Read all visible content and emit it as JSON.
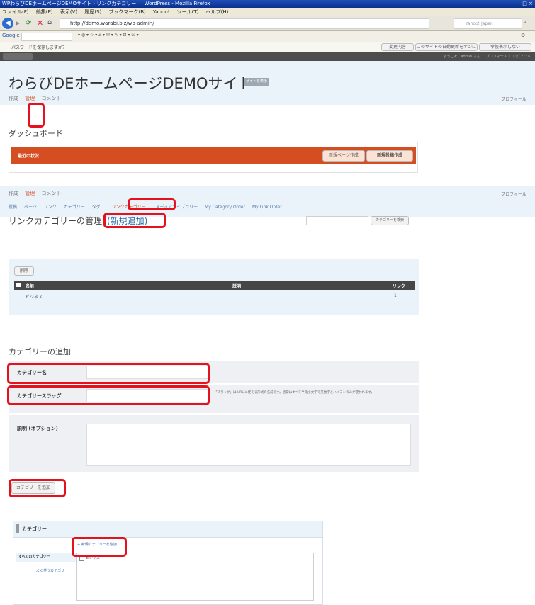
{
  "browser": {
    "title": "WPわらびDEホームページDEMOサイト › リンクカテゴリー — WordPress - Mozilla Firefox",
    "menu": [
      "ファイル(F)",
      "編集(E)",
      "表示(V)",
      "履歴(S)",
      "ブックマーク(B)",
      "Yahoo!",
      "ツール(T)",
      "ヘルプ(H)"
    ],
    "url": "http://demo.warabi.biz/wp-admin/",
    "search_placeholder": "Yahoo! Japan",
    "google_label": "Google",
    "bookmark_items": [
      "Googleツールバー",
      "パスワードを保存しますか？"
    ],
    "top_right_buttons": [
      "変更内容",
      "このサイトの自動更新をオンにする",
      "今後表示しない"
    ]
  },
  "site": {
    "title": "わらびDEホームページDEMOサイト",
    "visit_site_badge": "サイトを表示",
    "howdy": "ようこそ、admin さん ｜ プロフィール ｜ ログアウト"
  },
  "panel1": {
    "nav": [
      "作成",
      "管理",
      "コメント"
    ],
    "active_nav": "管理",
    "heading": "ダッシュボード",
    "orange_label": "最近の状況",
    "buttons": [
      "新規ページ作成",
      "新規投稿作成"
    ],
    "right_link": "プロフィール"
  },
  "panel2": {
    "nav": [
      "作成",
      "管理",
      "コメント"
    ],
    "subnav": [
      "投稿",
      "ページ",
      "リンク",
      "カテゴリー",
      "タグ",
      "リンクカテゴリー",
      "メディアライブラリー",
      "My Category Order",
      "My Link Order"
    ],
    "heading": "リンクカテゴリーの管理",
    "add_new": "(新規追加)",
    "search_button": "カテゴリーを検索",
    "delete_button": "削除",
    "table_headers": [
      "名前",
      "説明",
      "リンク"
    ],
    "rows": [
      {
        "name": "ビジネス",
        "desc": "",
        "count": "1"
      }
    ],
    "right_link": "プロフィール"
  },
  "panel3": {
    "heading": "カテゴリーの追加",
    "fields": [
      {
        "label": "カテゴリー名",
        "value": ""
      },
      {
        "label": "カテゴリースラッグ",
        "value": ""
      },
      {
        "label": "説明 (オプション)",
        "value": ""
      }
    ],
    "slug_help": "「スラッグ」は URL に使える形式の名前です。通常はすべて半角小文字で英数字とハイフンのみが使われます。",
    "submit": "カテゴリーを追加"
  },
  "panel4": {
    "heading": "カテゴリー",
    "add_link": "+ 新規カテゴリーを追加",
    "tabs": [
      "すべてのカテゴリー",
      "よく使うカテゴリー"
    ],
    "checked_item": "ビジネス"
  },
  "colors": {
    "highlight_red": "#e5121d",
    "dashboard_orange": "#d54e21",
    "table_header_dark": "#464646"
  }
}
